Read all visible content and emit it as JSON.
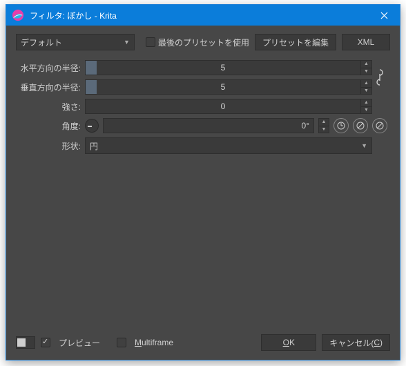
{
  "title": "フィルタ: ぼかし - Krita",
  "toprow": {
    "preset_selected": "デフォルト",
    "use_last_preset_label": "最後のプリセットを使用",
    "use_last_preset_checked": false,
    "edit_presets_label": "プリセットを編集",
    "xml_label": "XML"
  },
  "params": {
    "hradius_label": "水平方向の半径:",
    "hradius_value": "5",
    "vradius_label": "垂直方向の半径:",
    "vradius_value": "5",
    "link_radii": true,
    "strength_label": "強さ:",
    "strength_value": "0",
    "angle_label": "角度:",
    "angle_value": "0°",
    "shape_label": "形状:",
    "shape_value": "円"
  },
  "footer": {
    "preview_label": "プレビュー",
    "preview_checked": true,
    "multiframe_label_prefix": "M",
    "multiframe_label_rest": "ultiframe",
    "multiframe_checked": false,
    "ok_prefix": "O",
    "ok_rest": "K",
    "cancel_text": "キャンセル(",
    "cancel_mn": "C",
    "cancel_suffix": ")"
  }
}
